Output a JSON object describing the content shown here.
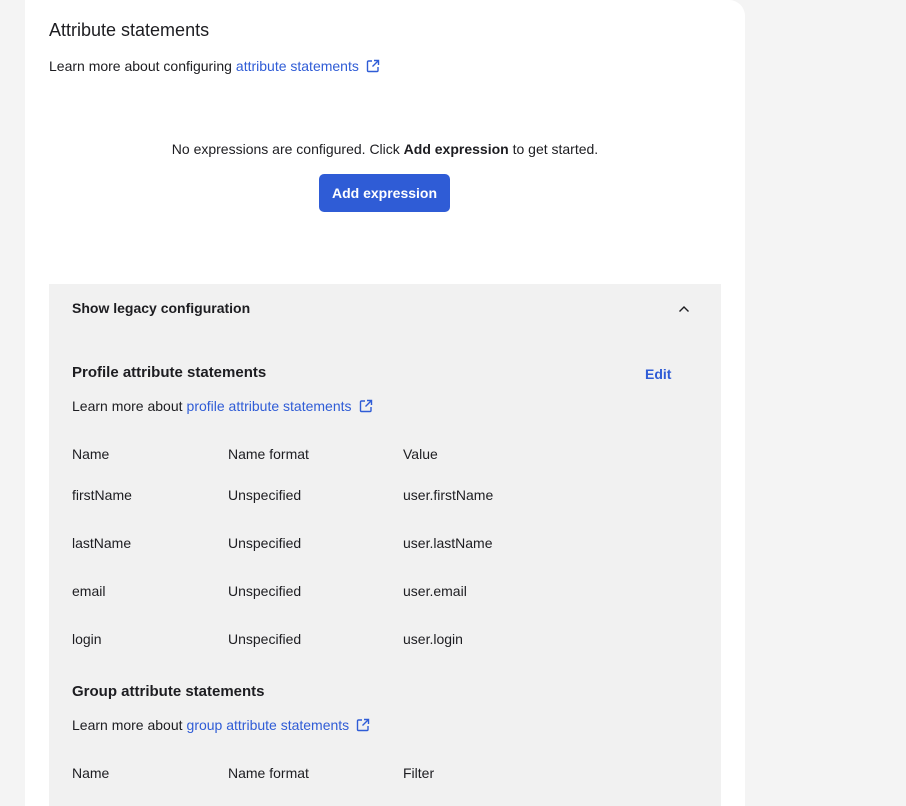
{
  "card": {
    "title": "Attribute statements",
    "learn_prefix": "Learn more about configuring",
    "learn_link": "attribute statements",
    "empty_before": "No expressions are configured. Click",
    "empty_bold": "Add expression",
    "empty_after": "to get started.",
    "add_button": "Add expression"
  },
  "legacy": {
    "toggle_label": "Show legacy configuration",
    "toggle_icon": "chevron-up-icon",
    "profile": {
      "title": "Profile attribute statements",
      "edit_label": "Edit",
      "learn_prefix": "Learn more about",
      "learn_link": "profile attribute statements",
      "columns": [
        "Name",
        "Name format",
        "Value"
      ],
      "rows": [
        [
          "firstName",
          "Unspecified",
          "user.firstName"
        ],
        [
          "lastName",
          "Unspecified",
          "user.lastName"
        ],
        [
          "email",
          "Unspecified",
          "user.email"
        ],
        [
          "login",
          "Unspecified",
          "user.login"
        ]
      ]
    },
    "group": {
      "title": "Group attribute statements",
      "learn_prefix": "Learn more about",
      "learn_link": "group attribute statements",
      "columns": [
        "Name",
        "Name format",
        "Filter"
      ]
    }
  },
  "colors": {
    "accent": "#2f5cd6",
    "panel": "#f1f1f1",
    "background": "#f4f4f4"
  }
}
